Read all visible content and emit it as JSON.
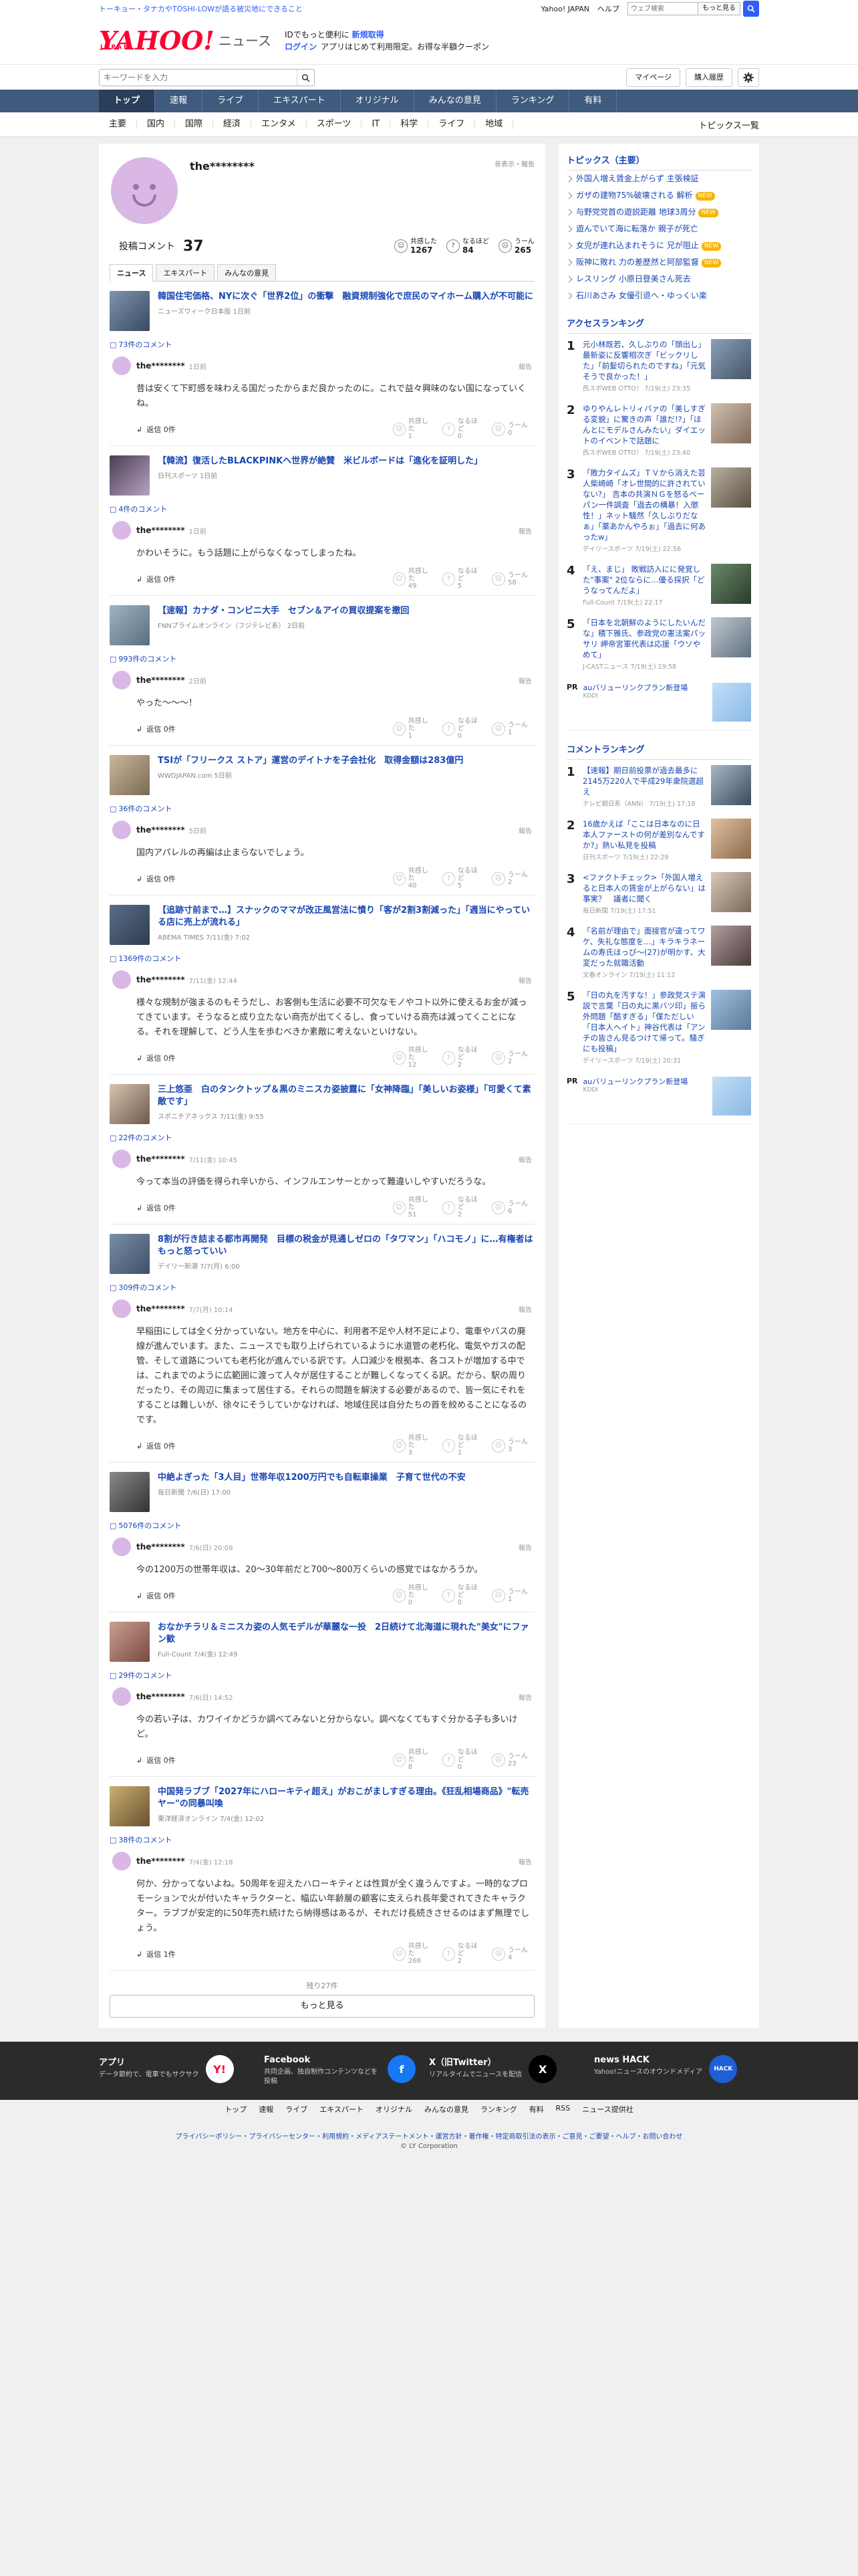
{
  "topbar": {
    "promo": "トーキョー・タナカやTOSHI-LOWが語る被災地にできること",
    "yahoo_japan": "Yahoo! JAPAN",
    "help": "ヘルプ",
    "search_placeholder": "ウェブ検索",
    "search_button": "もっと見る"
  },
  "header": {
    "logo": "YAHOO!",
    "logo_sub": "JAPAN",
    "logo_news": "ニュース",
    "promo_line1_prefix": "IDでもっと便利に",
    "promo_line1_link": "新規取得",
    "promo_login": "ログイン",
    "promo_line2": "アプリはじめて利用限定。お得な半額クーポン"
  },
  "searchbar": {
    "placeholder": "キーワードを入力",
    "mypage": "マイページ",
    "purchase_history": "購入履歴"
  },
  "global_nav": [
    "トップ",
    "速報",
    "ライブ",
    "エキスパート",
    "オリジナル",
    "みんなの意見",
    "ランキング",
    "有料"
  ],
  "sub_nav": [
    "主要",
    "国内",
    "国際",
    "経済",
    "エンタメ",
    "スポーツ",
    "IT",
    "科学",
    "ライフ",
    "地域"
  ],
  "sub_nav_topics": "トピックス一覧",
  "profile": {
    "name": "the********",
    "note": "非表示・報告",
    "comment_label": "投稿コメント",
    "comment_count": "37",
    "reactions": [
      {
        "label": "共感した",
        "value": "1267"
      },
      {
        "label": "なるほど",
        "value": "84"
      },
      {
        "label": "うーん",
        "value": "265"
      }
    ]
  },
  "tabs": [
    "ニュース",
    "エキスパート",
    "みんなの意見"
  ],
  "entries": [
    {
      "title": "韓国住宅価格、NYに次ぐ「世界2位」の衝撃　融資規制強化で庶民のマイホーム購入が不可能に",
      "meta": "ニューズウィーク日本版 1日前",
      "ccount": "73件のコメント",
      "date": "1日前",
      "text": "昔は安くて下町感を味わえる国だったからまだ良かったのに。これで益々興味のない国になっていくね。",
      "reply": "返信 0件",
      "rx": [
        "1",
        "0",
        "0"
      ]
    },
    {
      "title": "【韓流】復活したBLACKPINKへ世界が絶賛　米ビルボードは「進化を証明した」",
      "meta": "日刊スポーツ 1日前",
      "ccount": "4件のコメント",
      "date": "1日前",
      "text": "かわいそうに。もう話題に上がらなくなってしまったね。",
      "reply": "返信 0件",
      "rx": [
        "49",
        "5",
        "58"
      ]
    },
    {
      "title": "【速報】カナダ・コンビニ大手　セブン＆アイの買収提案を撤回",
      "meta": "FNNプライムオンライン（フジテレビ系） 2日前",
      "ccount": "993件のコメント",
      "date": "2日前",
      "text": "やった〜〜〜！",
      "reply": "返信 0件",
      "rx": [
        "1",
        "0",
        "1"
      ]
    },
    {
      "title": "TSIが「フリークス ストア」運営のデイトナを子会社化　取得金額は283億円",
      "meta": "WWDJAPAN.com 5日前",
      "ccount": "36件のコメント",
      "date": "5日前",
      "text": "国内アパレルの再編は止まらないでしょう。",
      "reply": "返信 0件",
      "rx": [
        "40",
        "5",
        "2"
      ]
    },
    {
      "title": "【追跡寸前まで…】スナックのママが改正風営法に憤り「客が2割3割減った」「週当にやっている店に売上が流れる」",
      "meta": "ABEMA TIMES 7/11(金) 7:02",
      "ccount": "1369件のコメント",
      "date": "7/11(金) 12:44",
      "text": "様々な規制が強まるのもそうだし、お客側も生活に必要不可欠なモノやコト以外に使えるお金が減ってきています。そうなると成り立たない商売が出てくるし、食っていける商売は減ってくことになる。それを理解して、どう人生を歩むべきか素敵に考えないといけない。",
      "reply": "返信 0件",
      "rx": [
        "12",
        "2",
        "2"
      ]
    },
    {
      "title": "三上悠亜　白のタンクトップ＆黒のミニスカ姿披露に「女神降臨」「美しいお姿様」「可愛くて素敵です」",
      "meta": "スポニチアネックス 7/11(金) 9:55",
      "ccount": "22件のコメント",
      "date": "7/11(金) 10:45",
      "text": "今って本当の評価を得られ辛いから、インフルエンサーとかって難違いしやすいだろうな。",
      "reply": "返信 0件",
      "rx": [
        "51",
        "2",
        "6"
      ]
    },
    {
      "title": "8割が行き詰まる都市再開発　目標の税金が見通しゼロの「タワマン」「ハコモノ」に…有権者はもっと怒っていい",
      "meta": "デイリー新潮 7/7(月) 6:00",
      "ccount": "309件のコメント",
      "date": "7/7(月) 10:14",
      "text": "早稲田にしては全く分かっていない。地方を中心に、利用者不足や人材不足により、電車やバスの廃線が進んでいます。また、ニュースでも取り上げられているように水道管の老朽化、電気やガスの配管、そして道路についても老朽化が進んでいる訳です。人口減少を根拠本、各コストが増加する中では、これまでのように広範囲に渡って人々が居住することが難しくなってくる訳。だから、駅の周りだったり、その周辺に集まって居住する。それらの問題を解決する必要があるので、皆一気にそれをすることは難しいが、徐々にそうしていかなければ、地域住民は自分たちの首を絞めることになるのです。",
      "reply": "返信 0件",
      "rx": [
        "3",
        "1",
        "3"
      ]
    },
    {
      "title": "中絶よぎった「3人目」世帯年収1200万円でも自転車操業　子育て世代の不安",
      "meta": "毎日新聞 7/6(日) 17:00",
      "ccount": "5076件のコメント",
      "date": "7/6(日) 20:09",
      "text": "今の1200万の世帯年収は、20〜30年前だと700〜800万くらいの感覚ではなかろうか。",
      "reply": "返信 0件",
      "rx": [
        "0",
        "0",
        "1"
      ]
    },
    {
      "title": "おなかチラリ＆ミニスカ姿の人気モデルが華麗な一投　2日続けて北海道に現れた\"美女\"にファン歓",
      "meta": "Full-Count 7/4(金) 12:49",
      "ccount": "29件のコメント",
      "date": "7/6(日) 14:52",
      "text": "今の若い子は、カワイイかどうか調べてみないと分からない。調べなくてもすぐ分かる子も多いけど。",
      "reply": "返信 0件",
      "rx": [
        "8",
        "0",
        "23"
      ]
    },
    {
      "title": "中国発ラブブ「2027年にハローキティ超え」がおこがましすぎる理由。《狂乱相場商品》\"転売ヤー\"の同暴叫喚",
      "meta": "東洋経済オンライン 7/4(金) 12:02",
      "ccount": "38件のコメント",
      "date": "7/4(金) 12:18",
      "text": "何か、分かってないよね。50周年を迎えたハローキティとは性質が全く違うんですよ。一時的なプロモーションで火が付いたキャラクターと、幅広い年齢層の顧客に支えられ長年愛されてきたキャラクター。ラブブが安定的に50年売れ続けたら納得感はあるが、それだけ長続きさせるのはまず無理でしょう。",
      "reply": "返信 1件",
      "rx": [
        "268",
        "2",
        "4"
      ]
    }
  ],
  "comment_ui": {
    "report": "報告",
    "rx_labels": [
      "共感した",
      "なるほど",
      "うーん"
    ]
  },
  "more": {
    "remaining": "残り27件",
    "button": "もっと見る"
  },
  "sidebar": {
    "topics_title": "トピックス（主要）",
    "topics": [
      {
        "t": "外国人増え賃金上がらず 主張検証",
        "badge": ""
      },
      {
        "t": "ガザの建物75%破壊される 解析",
        "badge": "NEW"
      },
      {
        "t": "与野党党首の遊説距離 地球3周分",
        "badge": "NEW"
      },
      {
        "t": "遊んでいて海に転落か 親子が死亡",
        "badge": ""
      },
      {
        "t": "女児が連れ込まれそうに 兄が阻止",
        "badge": "NEW"
      },
      {
        "t": "阪神に敗れ 力の差歴然と阿部監督",
        "badge": "NEW"
      },
      {
        "t": "レスリング 小原日登美さん死去",
        "badge": ""
      },
      {
        "t": "石川あさみ 女優引退へ・ゆっくい楽",
        "badge": ""
      }
    ],
    "access_title": "アクセスランキング",
    "access": [
      {
        "n": "1",
        "t": "元小林既若、久しぶりの「頭出し」最新姿に反響相次ぎ「ビックリした」「前髪切られたのですね」「元気そうで良かった！」",
        "m": "西スポWEB OTTO！ 7/19(土) 23:35"
      },
      {
        "n": "2",
        "t": "ゆりやんレトリィバァの「美しすぎる変貌」に驚きの声「誰だ!?」「ほんとにモデルさんみたい」ダイエットのイベントで話題に",
        "m": "西スポWEB OTTO！ 7/19(土) 23:40"
      },
      {
        "n": "3",
        "t": "「敗力タイムズ」ＴＶから消えた芸人柴崎崎「オレ世間的に許されていない?」 吉本の共演ＮＧを怒るベーパン一件調査「過去の構暴！入懲性！」ネット騒然「久しぶりだなぁ」「薬あかんやろぉ」「過去に何あったw」",
        "m": "デイリースポーツ 7/19(土) 22:56"
      },
      {
        "n": "4",
        "t": "「え、まじ」 敗戦訪入にに発覚した\"事案\" 2位ならに…優る採択「どうなってんだよ」",
        "m": "Full-Count 7/19(土) 22:17"
      },
      {
        "n": "5",
        "t": "「日本を北朝鮮のようにしたいんだな」積下雅氏、参政党の憲法案パッサリ 岬帝宮軍代表は応援「ウソやめて」",
        "m": "J-CASTニュース 7/19(土) 19:58"
      }
    ],
    "pr1": {
      "label": "PR",
      "title": "auバリューリンクプラン新登場",
      "sponsor": "KDDI",
      "ad_mark": "広告 ⓘ ✕"
    },
    "comment_title": "コメントランキング",
    "comment_rank": [
      {
        "n": "1",
        "t": "【速報】期日前投票が過去最多に 2145万220人で平成29年衆院選超え",
        "m": "テレビ朝日系（ANN） 7/19(土) 17:18"
      },
      {
        "n": "2",
        "t": "16歳かえば「ここは日本なのに日本人ファーストの何が差別なんですか?」熱い私見を投稿",
        "m": "日刊スポーツ 7/19(土) 22:29"
      },
      {
        "n": "3",
        "t": "<ファクトチェック>「外国人増えると日本人の賃金が上がらない」は事実？　議者に聞く",
        "m": "毎日新聞 7/19(土) 17:51"
      },
      {
        "n": "4",
        "t": "「名前が理由で」面接官が違ってワケ、失礼な態度を…」キラキラネームの寿氏ほっぴ〜(27)が明かす、大変だった就職活動",
        "m": "文春オンライン 7/19(土) 11:12"
      },
      {
        "n": "5",
        "t": "「日の丸を汚すな！」参政党ステ演説で言葉「日の丸に黒バツ印」振ら外問題「酷すぎる」「僕ただしい「日本人へイト」神谷代表は「アンチの皆さん見るつけて帰って。騒ぎにも投稿」",
        "m": "デイリースポーツ 7/19(土) 20:31"
      }
    ],
    "pr2": {
      "label": "PR",
      "title": "auバリューリンクプラン新登場",
      "sponsor": "KDDI",
      "ad_mark": "広告 ⓘ ✕"
    }
  },
  "footer": {
    "cols": [
      {
        "h": "アプリ",
        "d": "データ節約で、電車でもサクサク",
        "icon": "Y!"
      },
      {
        "h": "Facebook",
        "d": "共同企画、独自制作コンテンツなどを投稿",
        "icon": "f"
      },
      {
        "h": "X（旧Twitter）",
        "d": "リアルタイムでニュースを配信",
        "icon": "X"
      },
      {
        "h": "news HACK",
        "d": "Yahoo!ニュースのオウンドメディア",
        "icon": "HACK"
      }
    ],
    "links": [
      "トップ",
      "速報",
      "ライブ",
      "エキスパート",
      "オリジナル",
      "みんなの意見",
      "ランキング",
      "有料",
      "RSS",
      "ニュース提供社"
    ],
    "legal": "プライバシーポリシー・プライバシーセンター・利用規約・メディアステートメント・運営方針・著作権・特定商取引法の表示・ご意見・ご要望・ヘルプ・お問い合わせ",
    "copyright": "© LY Corporation"
  }
}
